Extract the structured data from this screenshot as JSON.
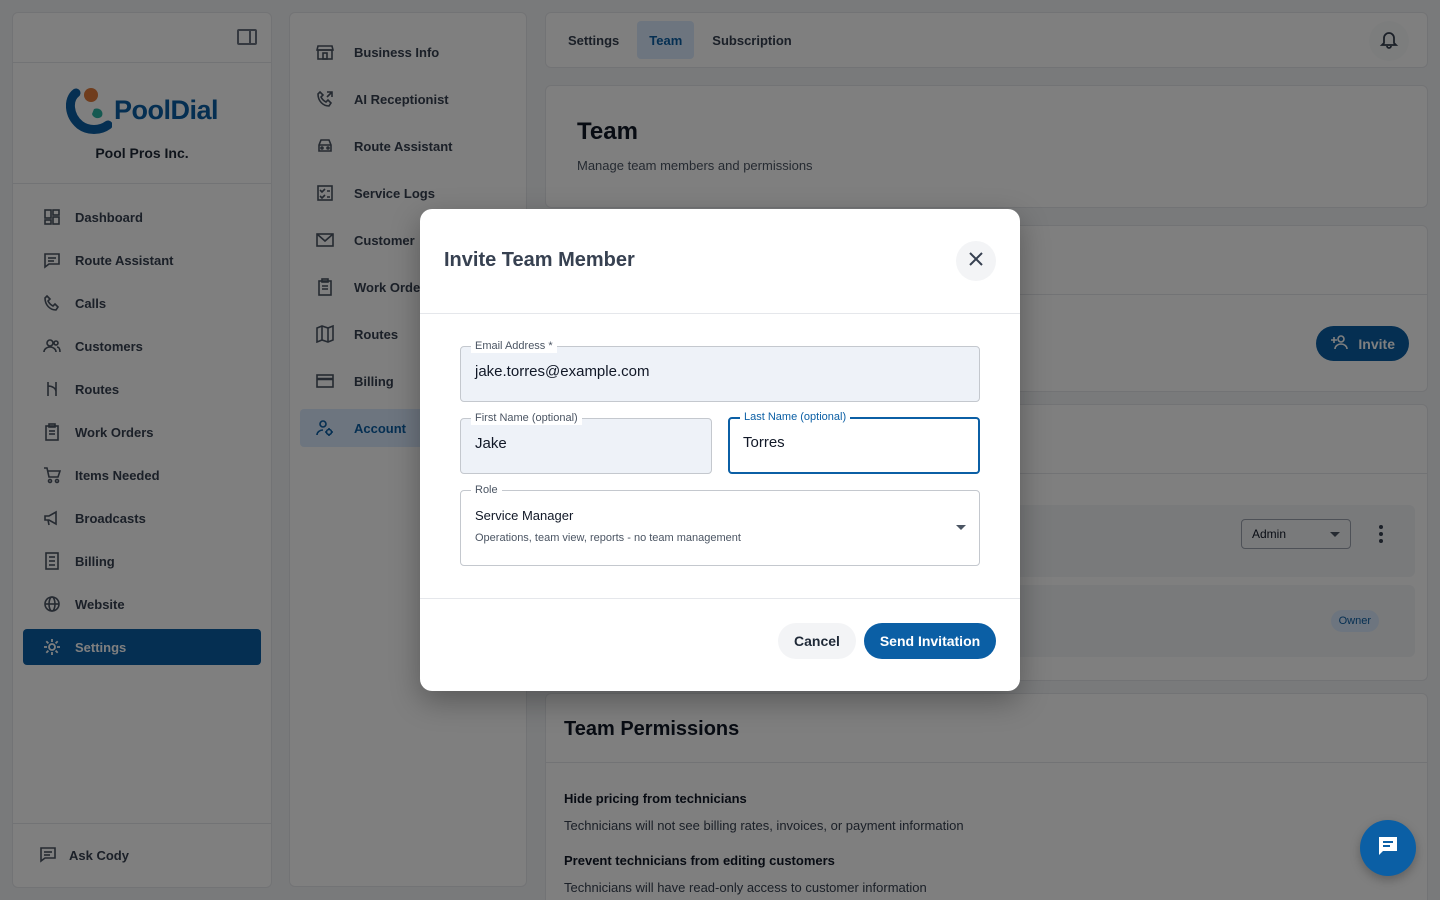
{
  "sidebar": {
    "brand_name": "PoolDial",
    "company": "Pool Pros Inc.",
    "items": [
      {
        "label": "Dashboard",
        "icon": "dashboard-icon"
      },
      {
        "label": "Route Assistant",
        "icon": "chat-icon"
      },
      {
        "label": "Calls",
        "icon": "phone-icon"
      },
      {
        "label": "Customers",
        "icon": "people-icon"
      },
      {
        "label": "Routes",
        "icon": "route-icon"
      },
      {
        "label": "Work Orders",
        "icon": "clipboard-icon"
      },
      {
        "label": "Items Needed",
        "icon": "cart-icon"
      },
      {
        "label": "Broadcasts",
        "icon": "megaphone-icon"
      },
      {
        "label": "Billing",
        "icon": "receipt-icon"
      },
      {
        "label": "Website",
        "icon": "globe-icon"
      },
      {
        "label": "Settings",
        "icon": "gear-icon",
        "active": true
      }
    ],
    "ask_label": "Ask Cody"
  },
  "settings_nav": {
    "items": [
      {
        "label": "Business Info",
        "icon": "storefront-icon"
      },
      {
        "label": "AI Receptionist",
        "icon": "phone-forward-icon"
      },
      {
        "label": "Route Assistant",
        "icon": "car-icon"
      },
      {
        "label": "Service Logs",
        "icon": "checklist-icon"
      },
      {
        "label": "Customer",
        "icon": "mail-icon"
      },
      {
        "label": "Work Orde",
        "icon": "clipboard-icon"
      },
      {
        "label": "Routes",
        "icon": "map-icon"
      },
      {
        "label": "Billing",
        "icon": "credit-card-icon"
      },
      {
        "label": "Account",
        "icon": "manage-accounts-icon",
        "active": true
      }
    ]
  },
  "tabs": [
    {
      "label": "Settings"
    },
    {
      "label": "Team",
      "active": true
    },
    {
      "label": "Subscription"
    }
  ],
  "page": {
    "title": "Team",
    "subtitle": "Manage team members and permissions",
    "invite_label": "Invite"
  },
  "members": {
    "role_value": "Admin",
    "owner_badge": "Owner"
  },
  "permissions": {
    "title": "Team Permissions",
    "items": [
      {
        "name": "Hide pricing from technicians",
        "desc": "Technicians will not see billing rates, invoices, or payment information"
      },
      {
        "name": "Prevent technicians from editing customers",
        "desc": "Technicians will have read-only access to customer information"
      }
    ]
  },
  "modal": {
    "title": "Invite Team Member",
    "email": {
      "label": "Email Address *",
      "value": "jake.torres@example.com"
    },
    "first_name": {
      "label": "First Name (optional)",
      "value": "Jake"
    },
    "last_name": {
      "label": "Last Name (optional)",
      "value": "Torres"
    },
    "role": {
      "label": "Role",
      "value": "Service Manager",
      "description": "Operations, team view, reports - no team management"
    },
    "cancel_label": "Cancel",
    "send_label": "Send Invitation"
  },
  "colors": {
    "primary": "#0b5fa5",
    "active_bg": "#dbeafe",
    "overlay": "rgba(0,0,0,0.5)"
  }
}
